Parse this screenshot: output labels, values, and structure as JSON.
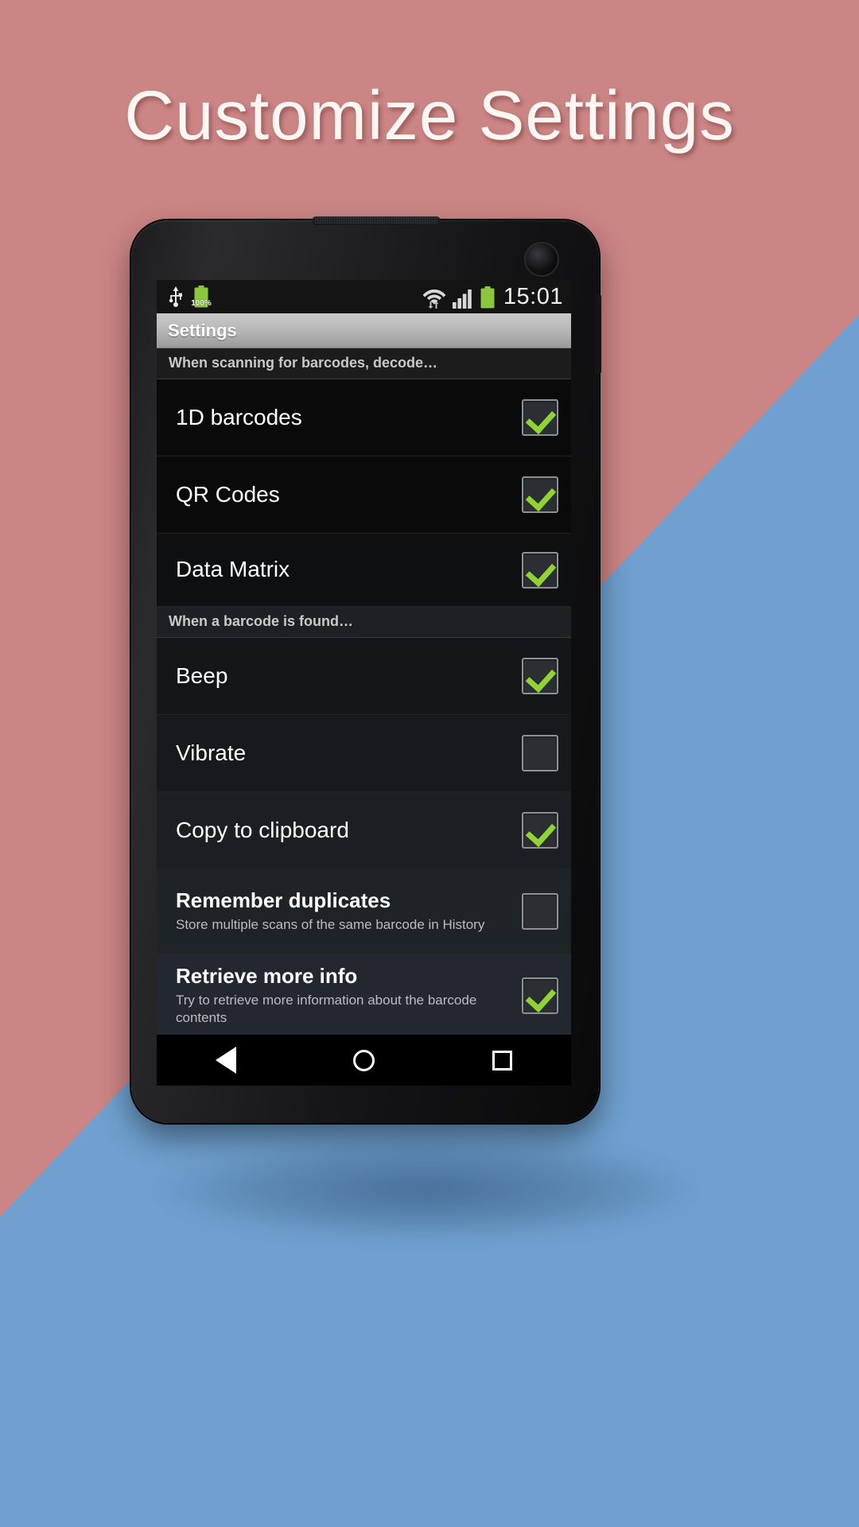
{
  "headline": "Customize Settings",
  "colors": {
    "bg_rose": "#cc8585",
    "bg_blue": "#6fa0cf",
    "accent_green": "#8fd433",
    "actionbar": "#b6b6b6"
  },
  "phone": {
    "status_bar": {
      "icons_left": [
        "usb-icon",
        "battery-icon"
      ],
      "battery_percent": "100%",
      "icons_right": [
        "wifi-icon",
        "signal-icon",
        "battery-icon"
      ],
      "time": "15:01"
    },
    "action_bar": {
      "title": "Settings"
    },
    "nav_bar": {
      "back": "back-triangle-icon",
      "home": "home-circle-icon",
      "recents": "recents-square-icon"
    }
  },
  "settings": {
    "sections": [
      {
        "header": "When scanning for barcodes, decode…",
        "rows": [
          {
            "title": "1D barcodes",
            "summary": "",
            "checked": true
          },
          {
            "title": "QR Codes",
            "summary": "",
            "checked": true
          },
          {
            "title": "Data Matrix",
            "summary": "",
            "checked": true
          }
        ]
      },
      {
        "header": "When a barcode is found…",
        "rows": [
          {
            "title": "Beep",
            "summary": "",
            "checked": true
          },
          {
            "title": "Vibrate",
            "summary": "",
            "checked": false
          },
          {
            "title": "Copy to clipboard",
            "summary": "",
            "checked": true
          },
          {
            "title": "Remember duplicates",
            "summary": "Store multiple scans of the same barcode in History",
            "checked": false
          },
          {
            "title": "Retrieve more info",
            "summary": "Try to retrieve more information about the barcode contents",
            "checked": true
          }
        ]
      }
    ]
  }
}
